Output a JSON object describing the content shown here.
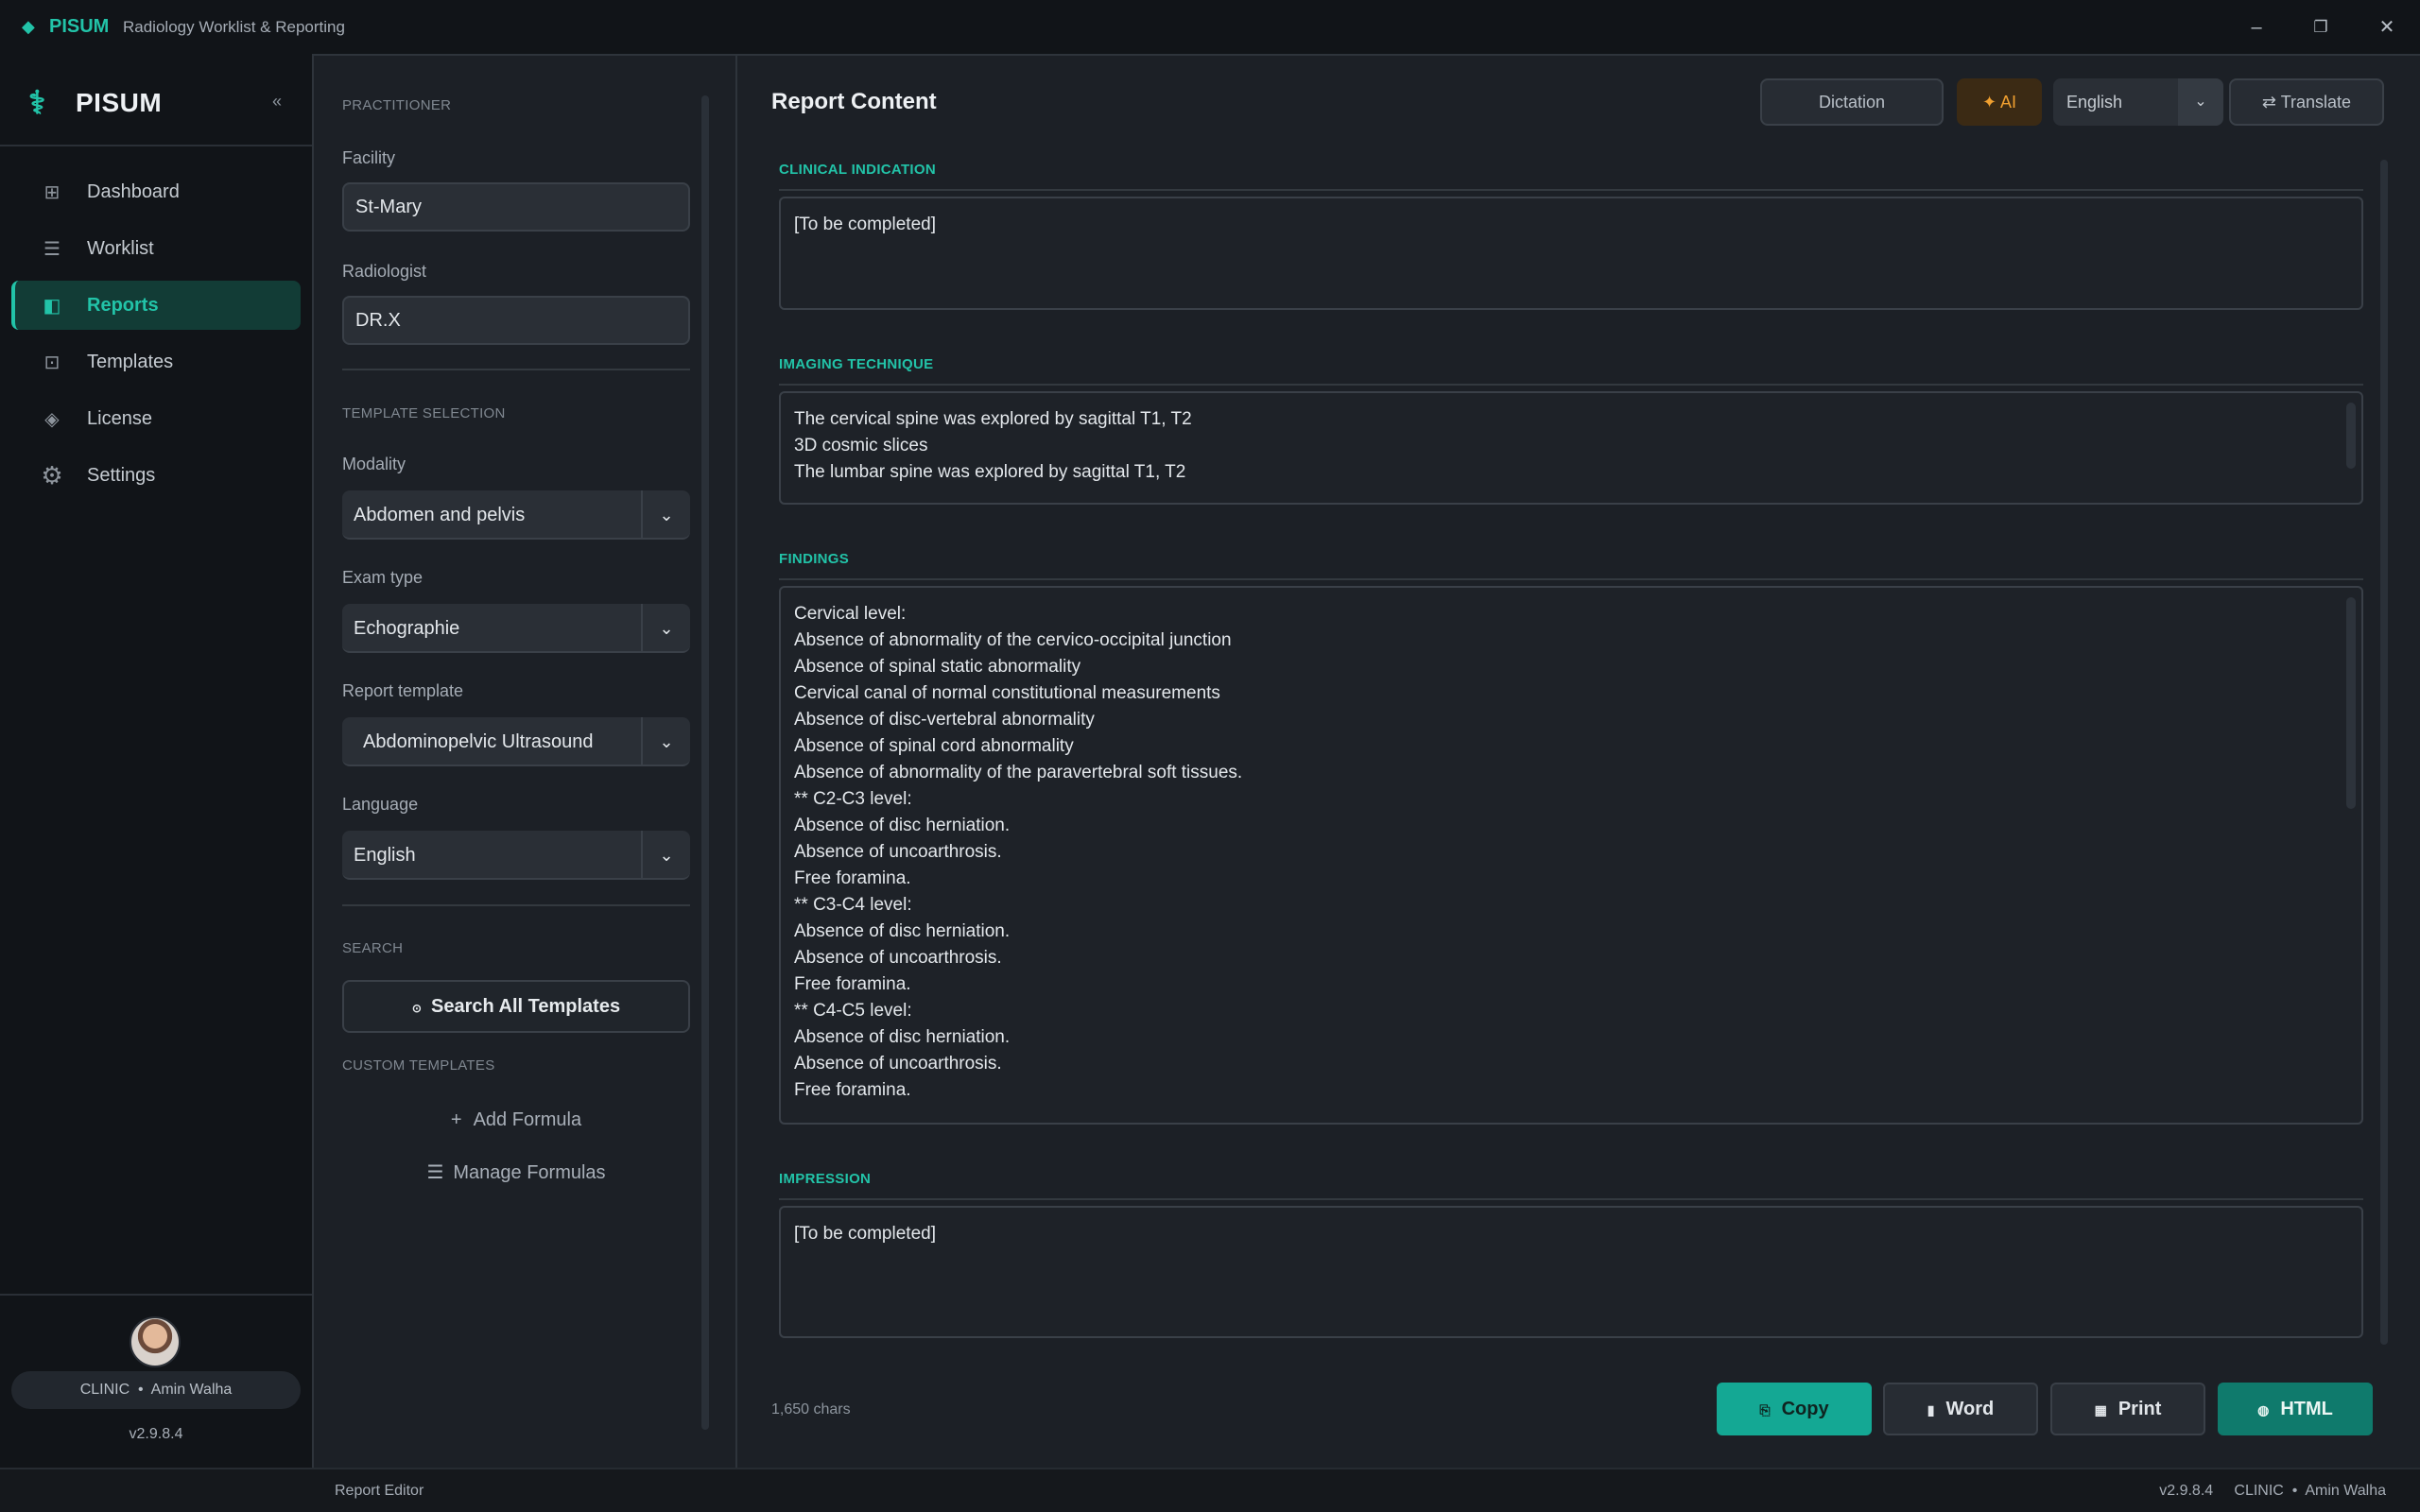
{
  "titlebar": {
    "app_name": "PISUM",
    "subtitle": "Radiology Worklist & Reporting",
    "minimize": "–",
    "maximize": "❐",
    "close": "✕"
  },
  "sidebar": {
    "brand": "PISUM",
    "collapse": "«",
    "items": [
      {
        "label": "Dashboard",
        "icon": "⊞"
      },
      {
        "label": "Worklist",
        "icon": "☰"
      },
      {
        "label": "Reports",
        "icon": "◧"
      },
      {
        "label": "Templates",
        "icon": "⊡"
      },
      {
        "label": "License",
        "icon": "◈"
      },
      {
        "label": "Settings",
        "icon": "⚙"
      }
    ],
    "user": "CLINIC  •  Amin Walha",
    "version": "v2.9.8.4"
  },
  "config": {
    "practitioner_title": "PRACTITIONER",
    "facility_label": "Facility",
    "facility_value": "St-Mary",
    "radiologist_label": "Radiologist",
    "radiologist_value": "DR.X",
    "template_title": "TEMPLATE SELECTION",
    "modality_label": "Modality",
    "modality_value": "Abdomen and pelvis",
    "exam_label": "Exam type",
    "exam_value": "Echographie",
    "template_label": "Report template",
    "template_value": "Abdominopelvic Ultrasound",
    "language_label": "Language",
    "language_value": "English",
    "search_title": "SEARCH",
    "search_button": "Search All Templates",
    "custom_title": "CUSTOM TEMPLATES",
    "add_formula": "Add Formula",
    "manage_formulas": "Manage Formulas"
  },
  "main": {
    "title": "Report Content",
    "dictation": "Dictation",
    "ai": "AI",
    "language": "English",
    "translate": "Translate",
    "sections": {
      "clinical": {
        "title": "CLINICAL INDICATION",
        "lines": [
          "[To be completed]"
        ]
      },
      "technique": {
        "title": "IMAGING TECHNIQUE",
        "lines": [
          "The cervical spine was explored by sagittal T1, T2",
          "3D cosmic slices",
          "The lumbar spine was explored by sagittal T1, T2"
        ]
      },
      "findings": {
        "title": "FINDINGS",
        "lines": [
          "Cervical level:",
          "Absence of abnormality of the cervico-occipital junction",
          "Absence of spinal static abnormality",
          "Cervical canal of normal constitutional measurements",
          "Absence of disc-vertebral abnormality",
          "Absence of spinal cord abnormality",
          "Absence of abnormality of the paravertebral soft tissues.",
          "** C2-C3 level:",
          "Absence of disc herniation.",
          "Absence of uncoarthrosis.",
          "Free foramina.",
          "** C3-C4 level:",
          "Absence of disc herniation.",
          "Absence of uncoarthrosis.",
          "Free foramina.",
          "** C4-C5 level:",
          "Absence of disc herniation.",
          "Absence of uncoarthrosis.",
          "Free foramina."
        ]
      },
      "impression": {
        "title": "IMPRESSION",
        "lines": [
          "[To be completed]"
        ]
      }
    },
    "char_count": "1,650 chars",
    "actions": {
      "copy": "Copy",
      "word": "Word",
      "print": "Print",
      "html": "HTML"
    }
  },
  "status": {
    "left": "Report Editor",
    "right": "v2.9.8.4     CLINIC  •  Amin Walha"
  }
}
